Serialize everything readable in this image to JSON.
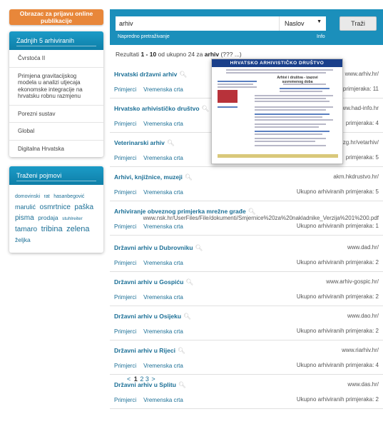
{
  "sidebar": {
    "report_button": "Obrazac za prijavu online publikacije",
    "archived": {
      "title": "Zadnjih 5 arhiviranih",
      "items": [
        "Čvrstoća II",
        "Primjena gravitacijskog modela u analizi utjecaja ekonomske integracije na hrvatsku robnu razmjenu",
        "Porezni sustav",
        "Global",
        "Digitalna Hrvatska"
      ]
    },
    "terms": {
      "title": "Traženi pojmovi",
      "tags": [
        {
          "label": "domovinski",
          "size": 7
        },
        {
          "label": "rat",
          "size": 7
        },
        {
          "label": "hasanbegović",
          "size": 7
        },
        {
          "label": "marulić",
          "size": 9
        },
        {
          "label": "osmrtnice",
          "size": 10
        },
        {
          "label": "paška",
          "size": 10
        },
        {
          "label": "pisma",
          "size": 10
        },
        {
          "label": "prodaja",
          "size": 8.5
        },
        {
          "label": "stuhlreiter",
          "size": 6.5
        },
        {
          "label": "tamaro",
          "size": 10
        },
        {
          "label": "tribina",
          "size": 11
        },
        {
          "label": "zelena",
          "size": 11
        },
        {
          "label": "željka",
          "size": 8.5
        }
      ]
    }
  },
  "search": {
    "query": "arhiv",
    "field": "Naslov",
    "button": "Traži",
    "advanced": "Napredno pretraživanje",
    "info": "Info"
  },
  "results": {
    "count_prefix": "Rezultati ",
    "count_range": "1 - 10",
    "count_mid": " od ukupno 24 za ",
    "count_query": "arhiv",
    "count_suffix": " (??? ...)",
    "links": {
      "copies": "Primjerci",
      "timeline": "Vremenska crta"
    },
    "items": [
      {
        "title": "Hrvatski državni arhiv",
        "url": "www.arhiv.hr/",
        "count": "primjeraka: 11"
      },
      {
        "title": "Hrvatsko arhivističko društvo",
        "url": "www.had-info.hr",
        "count": "primjeraka: 4"
      },
      {
        "title": "Veterinarski arhiv",
        "url": "zg.hr/vetarhiv/",
        "count": "primjeraka: 5"
      },
      {
        "title": "Arhivi, knjižnice, muzeji",
        "url": "akm.hkdrustvo.hr/",
        "count": "Ukupno arhiviranih primjeraka: 5"
      },
      {
        "title": "Arhiviranje obveznog primjerka mrežne građe",
        "url": "www.nsk.hr/UserFiles/File/dokumenti/Smjernice%20za%20nakladnike_Verzija%201%200.pdf",
        "count": "Ukupno arhiviranih primjeraka: 1"
      },
      {
        "title": "Državni arhiv u Dubrovniku",
        "url": "www.dad.hr/",
        "count": "Ukupno arhiviranih primjeraka: 2"
      },
      {
        "title": "Državni arhiv u Gospiću",
        "url": "www.arhiv-gospic.hr/",
        "count": "Ukupno arhiviranih primjeraka: 2"
      },
      {
        "title": "Državni arhiv u Osijeku",
        "url": "www.dao.hr/",
        "count": "Ukupno arhiviranih primjeraka: 2"
      },
      {
        "title": "Državni arhiv u Rijeci",
        "url": "www.riarhiv.hr/",
        "count": "Ukupno arhiviranih primjeraka: 4"
      },
      {
        "title": "Državni arhiv u Splitu",
        "url": "www.das.hr/",
        "count": "Ukupno arhiviranih primjeraka: 2"
      }
    ]
  },
  "pagination": {
    "prev": "<",
    "pages": [
      "1",
      "2",
      "3"
    ],
    "current": "1",
    "next": ">"
  },
  "preview": {
    "title": "HRVATSKO ARHIVISTIČKO DRUŠTVO",
    "heading": "Arhivi i društva - izazovi suvremenog doba"
  },
  "colors": {
    "accent": "#1b8fbb",
    "orange": "#e8873a",
    "link": "#1b6f96"
  }
}
